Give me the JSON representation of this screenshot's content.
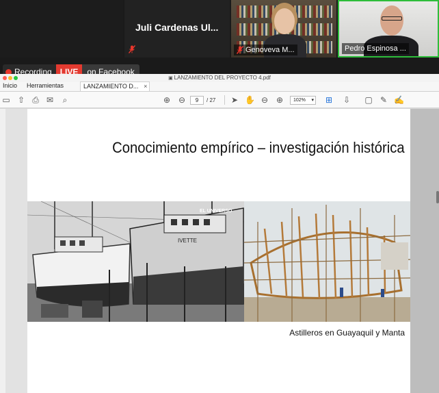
{
  "video": {
    "participants": [
      {
        "name": "Juli Cardenas Ul..."
      },
      {
        "name": "Genoveva M..."
      },
      {
        "name": "Pedro Espinosa ..."
      }
    ],
    "colors": {
      "active_speaker_border": "#2dbd3a",
      "muted_mic": "#e8372c"
    }
  },
  "recording": {
    "recording_label": "Recording",
    "live_label": "LIVE",
    "platform_label": "on Facebook"
  },
  "pdf": {
    "window_title": "LANZAMIENTO DEL PROYECTO 4.pdf",
    "tabs": [
      {
        "label": "Inicio"
      },
      {
        "label": "Herramientas"
      },
      {
        "label": "LANZAMIENTO D...",
        "close": "×"
      }
    ],
    "page_current": "9",
    "page_total": "/ 27",
    "zoom": "102%"
  },
  "slide": {
    "title": "Conocimiento empírico – investigación histórica",
    "caption": "Astilleros en Guayaquil y Manta",
    "photo_watermark": "EL UNIVERSO",
    "boat_name": "IVETTE"
  }
}
